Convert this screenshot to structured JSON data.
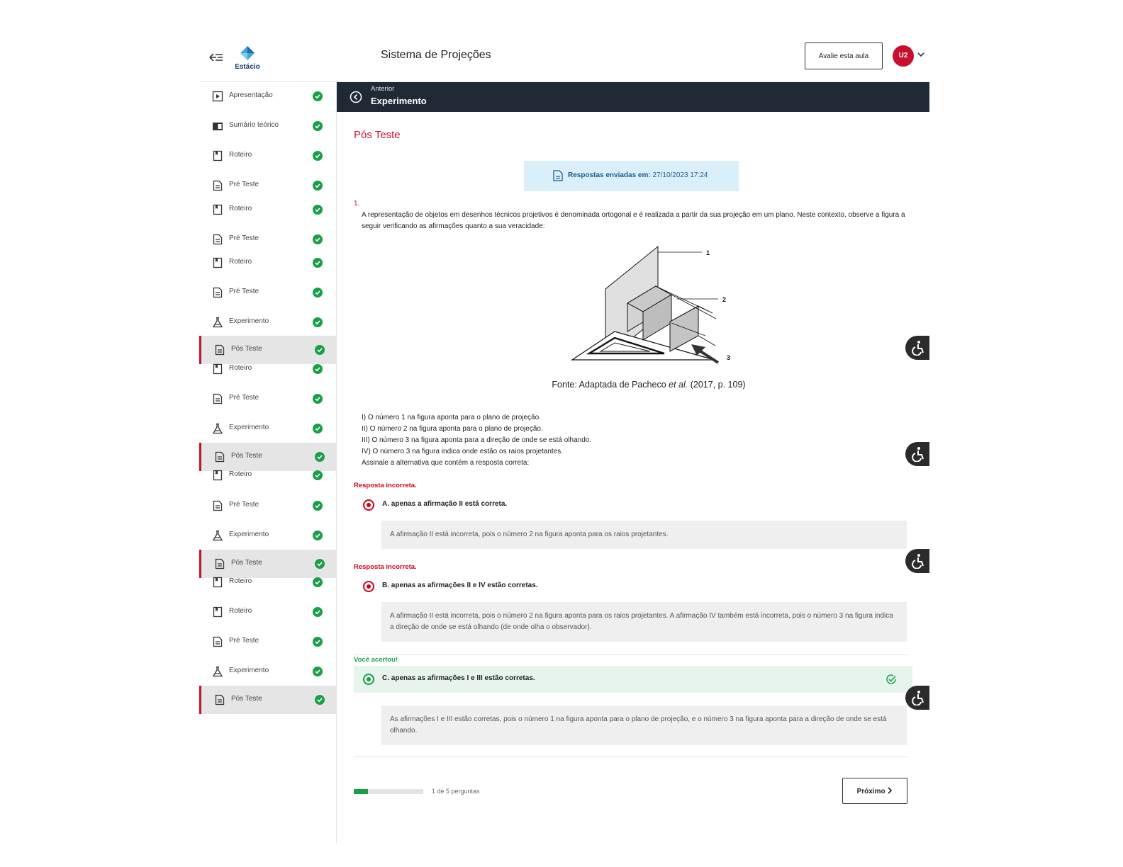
{
  "header": {
    "logo_text": "Estácio",
    "title": "Sistema de Projeções",
    "rate_button": "Avalie esta aula",
    "avatar_initials": "U2"
  },
  "sidebar": {
    "items": [
      {
        "label": "Apresentação",
        "icon": "play-icon",
        "done": true
      },
      {
        "label": "Sumário teórico",
        "icon": "book-open-icon",
        "done": true
      },
      {
        "label": "Roteiro",
        "icon": "bookmark-icon",
        "done": true
      },
      {
        "label": "Pré Teste",
        "icon": "document-icon",
        "done": true
      },
      {
        "label": "Roteiro",
        "icon": "bookmark-icon",
        "done": true
      },
      {
        "label": "Pré Teste",
        "icon": "document-icon",
        "done": true
      },
      {
        "label": "Roteiro",
        "icon": "bookmark-icon",
        "done": true
      },
      {
        "label": "Pré Teste",
        "icon": "document-icon",
        "done": true
      },
      {
        "label": "Experimento",
        "icon": "flask-icon",
        "done": true
      },
      {
        "label": "Pós Teste",
        "icon": "document-icon",
        "done": true,
        "active": true
      },
      {
        "label": "Roteiro",
        "icon": "bookmark-icon",
        "done": true
      },
      {
        "label": "Pré Teste",
        "icon": "document-icon",
        "done": true
      },
      {
        "label": "Experimento",
        "icon": "flask-icon",
        "done": true
      },
      {
        "label": "Pós Teste",
        "icon": "document-icon",
        "done": true,
        "active": true
      },
      {
        "label": "Roteiro",
        "icon": "bookmark-icon",
        "done": true
      },
      {
        "label": "Pré Teste",
        "icon": "document-icon",
        "done": true
      },
      {
        "label": "Experimento",
        "icon": "flask-icon",
        "done": true
      },
      {
        "label": "Pós Teste",
        "icon": "document-icon",
        "done": true,
        "active": true
      },
      {
        "label": "Roteiro",
        "icon": "bookmark-icon",
        "done": true
      },
      {
        "label": "Roteiro",
        "icon": "bookmark-icon",
        "done": true
      },
      {
        "label": "Pré Teste",
        "icon": "document-icon",
        "done": true
      },
      {
        "label": "Experimento",
        "icon": "flask-icon",
        "done": true
      },
      {
        "label": "Pós Teste",
        "icon": "document-icon",
        "done": true,
        "active": true
      }
    ]
  },
  "topbar": {
    "previous_label": "Anterior",
    "current_label": "Experimento"
  },
  "main": {
    "heading": "Pós Teste",
    "submitted_label": "Respostas enviadas em:",
    "submitted_date": "27/10/2023 17:24",
    "question_number": "1.",
    "question_stem": "A representação de objetos em desenhos técnicos projetivos é denominada ortogonal e é realizada a partir da sua projeção em um plano. Neste contexto, observe a figura a seguir verificando as afirmações quanto a sua veracidade:",
    "figure_labels": [
      "1",
      "2",
      "3"
    ],
    "figure_caption_pre": "Fonte: Adaptada de Pacheco ",
    "figure_caption_em": "et al.",
    "figure_caption_post": " (2017, p. 109)",
    "assertions": [
      "I) O número 1 na figura aponta para o plano de projeção.",
      "II) O número 2 na figura aponta para o plano de projeção.",
      "III) O número 3 na figura aponta para a direção de onde se está olhando.",
      "IV) O número 3 na figura indica onde estão os raios projetantes.",
      "Assinale a alternativa que contém a resposta correta:"
    ],
    "options": [
      {
        "feedback": "Resposta incorreta.",
        "text": "A. apenas a afirmação II está correta.",
        "explanation": "A afirmação II está incorreta, pois o número 2 na figura aponta para os raios projetantes."
      },
      {
        "feedback": "Resposta incorreta.",
        "text": "B. apenas as afirmações II e IV estão corretas.",
        "explanation": "A afirmação II está incorreta, pois o número 2 na figura aponta para os raios projetantes. A afirmação IV também está incorreta, pois o número 3 na figura indica a direção de onde se está olhando (de onde olha o observador)."
      },
      {
        "feedback": "Você acertou!",
        "text": "C. apenas as afirmações I e III estão corretas.",
        "explanation": "As afirmações I e III estão corretas, pois o número 1 na figura aponta para o plano de projeção, e o número 3 na figura aponta para a direção de onde se está olhando."
      }
    ],
    "progress_fraction": 0.2,
    "progress_text": "1 de 5 perguntas",
    "next_button": "Próximo"
  },
  "colors": {
    "brand_red": "#c8102e",
    "success_green": "#1a9f46",
    "topbar_bg": "#1f2a36",
    "info_bg": "#dbeffa"
  }
}
